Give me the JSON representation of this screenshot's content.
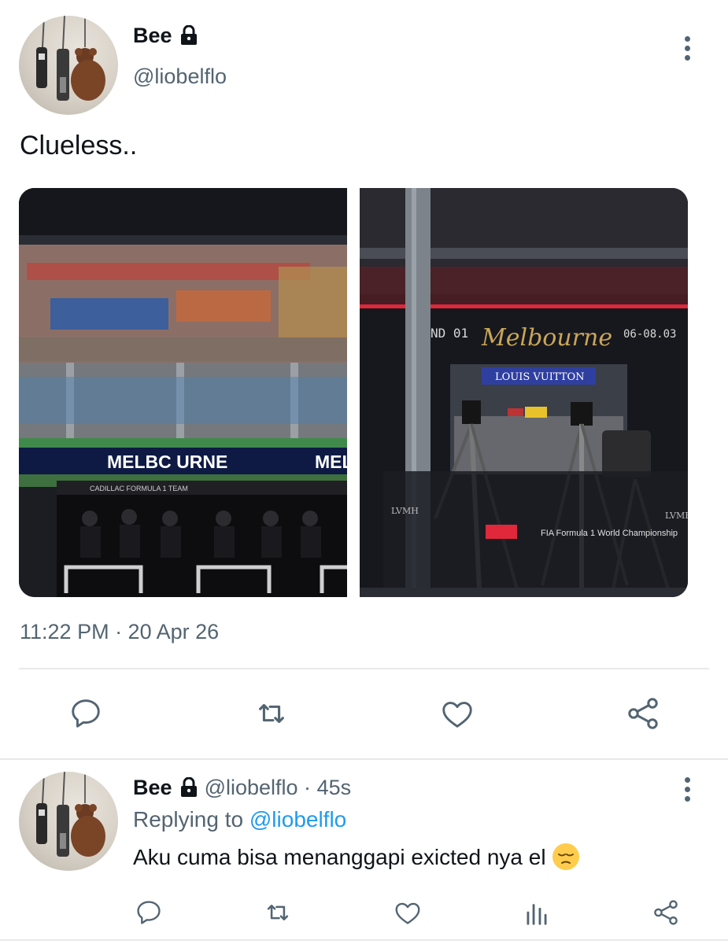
{
  "main_tweet": {
    "display_name": "Bee",
    "handle": "@liobelflo",
    "text": "Clueless..",
    "photos": {
      "left": {
        "sign_text": "MELBC URNE",
        "sign_text_right": "MEL",
        "pit_wall_label": "CADILLAC FORMULA 1 TEAM"
      },
      "right": {
        "round_text": "ND 01",
        "city_script": "Melbourne",
        "dates": "06-08.03",
        "screen_brand": "LOUIS VUITTON",
        "fia_text": "FIA Formula 1 World Championship",
        "lvmh_left": "LVMH",
        "lvmh_right": "LVMH"
      }
    },
    "timestamp": "11:22 PM · 20 Apr 26",
    "actions": [
      "reply-icon",
      "retweet-icon",
      "like-icon",
      "share-icon"
    ]
  },
  "reply": {
    "display_name": "Bee",
    "handle": "@liobelflo",
    "separator": "·",
    "time_ago": "45s",
    "replying_prefix": "Replying to",
    "replying_handle": "@liobelflo",
    "text": "Aku cuma bisa menanggapi exicted nya el",
    "emoji": "pensive-face",
    "actions": [
      "reply-icon",
      "retweet-icon",
      "like-icon",
      "analytics-icon",
      "share-icon"
    ]
  },
  "colors": {
    "text": "#0f1419",
    "secondary": "#536471",
    "link": "#1d9bf0",
    "divider": "#e7e9ea"
  }
}
